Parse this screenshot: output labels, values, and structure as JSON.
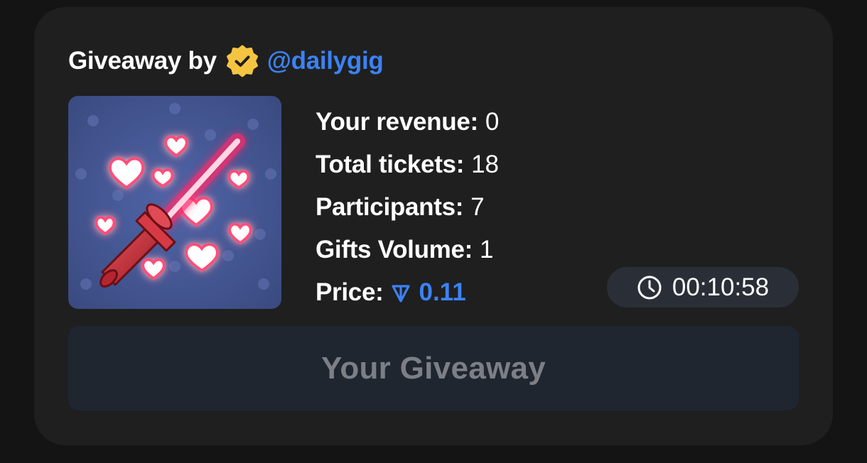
{
  "header": {
    "prefix": "Giveaway by",
    "author": "@dailygig",
    "verified_icon": "verified-badge-icon"
  },
  "gift": {
    "image_icon": "lightsaber-hearts-gift"
  },
  "stats": {
    "revenue_label": "Your revenue:",
    "revenue_value": "0",
    "tickets_label": "Total tickets:",
    "tickets_value": "18",
    "participants_label": "Participants:",
    "participants_value": "7",
    "volume_label": "Gifts Volume:",
    "volume_value": "1",
    "price_label": "Price:",
    "price_value": "0.11",
    "price_icon": "ton-icon"
  },
  "timer": {
    "icon": "clock-icon",
    "value": "00:10:58"
  },
  "action": {
    "label": "Your Giveaway"
  },
  "colors": {
    "background": "#141414",
    "card": "#1f1f1f",
    "accent": "#3b82f6",
    "badge": "#f5c542",
    "button": "#1f2630",
    "button_text": "#7c7f85"
  }
}
